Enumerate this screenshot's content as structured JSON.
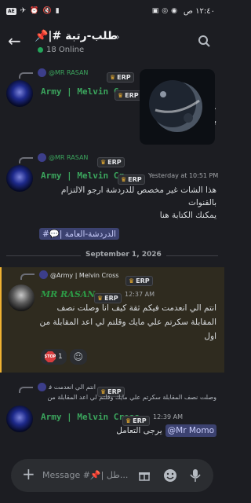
{
  "status_bar": {
    "time": "١٢:٤٠ ص",
    "badge": "AE"
  },
  "header": {
    "title": "طلب-رتبة #|📌",
    "online": "18 Online"
  },
  "messages": [
    {
      "reply": "@MR RASAN",
      "author": "Army | Melvin C...",
      "tag": "ERP",
      "text_lines": [
        "...",
        "بي"
      ]
    },
    {
      "reply": "@MR RASAN",
      "author": "Army | Melvin Cr...",
      "tag": "ERP",
      "timestamp": "Yesterday at 10:51 PM",
      "text_lines": [
        "هذا الشات غير مخصص للدردشة ارجو الالتزام",
        "بالقنوات",
        "يمكنك الكتابة هنا"
      ],
      "channel_link": "الدردشة-العامة |💬#"
    },
    {
      "reply": "@Army | Melvin Cross",
      "reply_tag": "ERP",
      "author": "MR RASAN",
      "tag": "ERP",
      "timestamp": "12:37 AM",
      "text_lines": [
        "انتم الي انعدمت فيكم ثقة كيف انا وصلت نصف",
        "المقابلة سكرتم علي مايك وقلتم لي اعد المقابلة من",
        "اول"
      ],
      "reaction_count": "1",
      "reaction_emoji": "STOP"
    },
    {
      "reply": "انتم الي انعدمت فيكم ثقة كيف",
      "reply_tag": "ERP",
      "reply_line2": "وصلت نصف المقابلة سكرتم علي مايك وقلتم لي اعد المقابلة من",
      "author": "Army | Melvin Cross",
      "tag": "ERP",
      "timestamp": "12:39 AM",
      "text": "يرجى التعامل",
      "mention": "@Mr Momo"
    }
  ],
  "date_divider": "September 1, 2026",
  "input": {
    "placeholder": "Message #📌| طل..."
  },
  "icons": [
    "back-arrow-icon",
    "search-icon",
    "plus-icon",
    "gift-icon",
    "emoji-icon",
    "microphone-icon",
    "erp-badge-icon"
  ]
}
